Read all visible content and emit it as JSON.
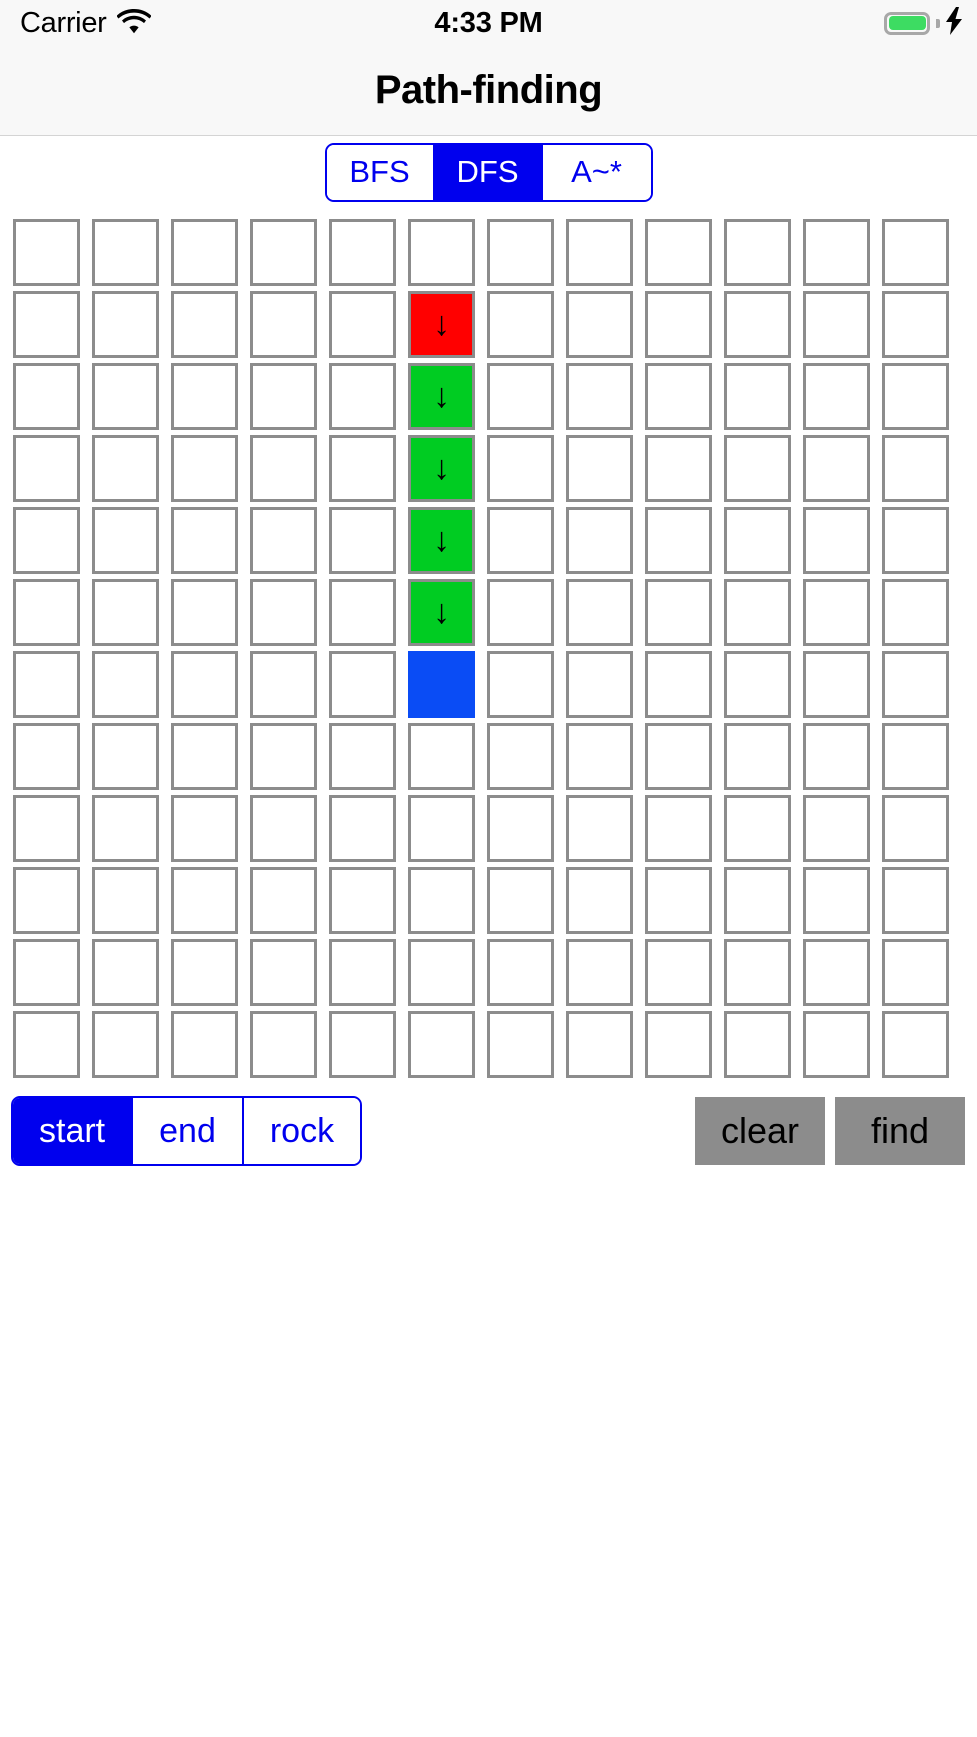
{
  "status_bar": {
    "carrier": "Carrier",
    "wifi_icon": "wifi-icon",
    "time": "4:33 PM",
    "battery_icon": "battery-icon",
    "battery_level_percent": 100,
    "battery_color": "#3ddc62",
    "charging_icon": "lightning-bolt-icon"
  },
  "nav": {
    "title": "Path-finding"
  },
  "algorithm_control": {
    "name": "algorithm-segmented-control",
    "selected": "DFS",
    "accent_color": "#0000ee",
    "options": [
      {
        "label": "BFS",
        "selected": false
      },
      {
        "label": "DFS",
        "selected": true
      },
      {
        "label": "A~*",
        "selected": false
      }
    ]
  },
  "grid": {
    "columns": 12,
    "rows": 12,
    "legend": {
      "empty_color": "#ffffff",
      "start_color": "#ff0000",
      "path_color": "#00cc22",
      "end_color": "#0a4cf5",
      "border_color": "#8c8c8c"
    },
    "cells": [
      {
        "row": 1,
        "col": 5,
        "state": "start",
        "glyph": "↓"
      },
      {
        "row": 2,
        "col": 5,
        "state": "path",
        "glyph": "↓"
      },
      {
        "row": 3,
        "col": 5,
        "state": "path",
        "glyph": "↓"
      },
      {
        "row": 4,
        "col": 5,
        "state": "path",
        "glyph": "↓"
      },
      {
        "row": 5,
        "col": 5,
        "state": "path",
        "glyph": "↓"
      },
      {
        "row": 6,
        "col": 5,
        "state": "end",
        "glyph": ""
      }
    ]
  },
  "toolbar": {
    "mode_control": {
      "name": "paint-mode-segmented-control",
      "selected": "start",
      "accent_color": "#0000ee",
      "options": [
        {
          "label": "start",
          "selected": true
        },
        {
          "label": "end",
          "selected": false
        },
        {
          "label": "rock",
          "selected": false
        }
      ]
    },
    "actions": [
      {
        "label": "clear",
        "name": "clear-button"
      },
      {
        "label": "find",
        "name": "find-button"
      }
    ]
  }
}
